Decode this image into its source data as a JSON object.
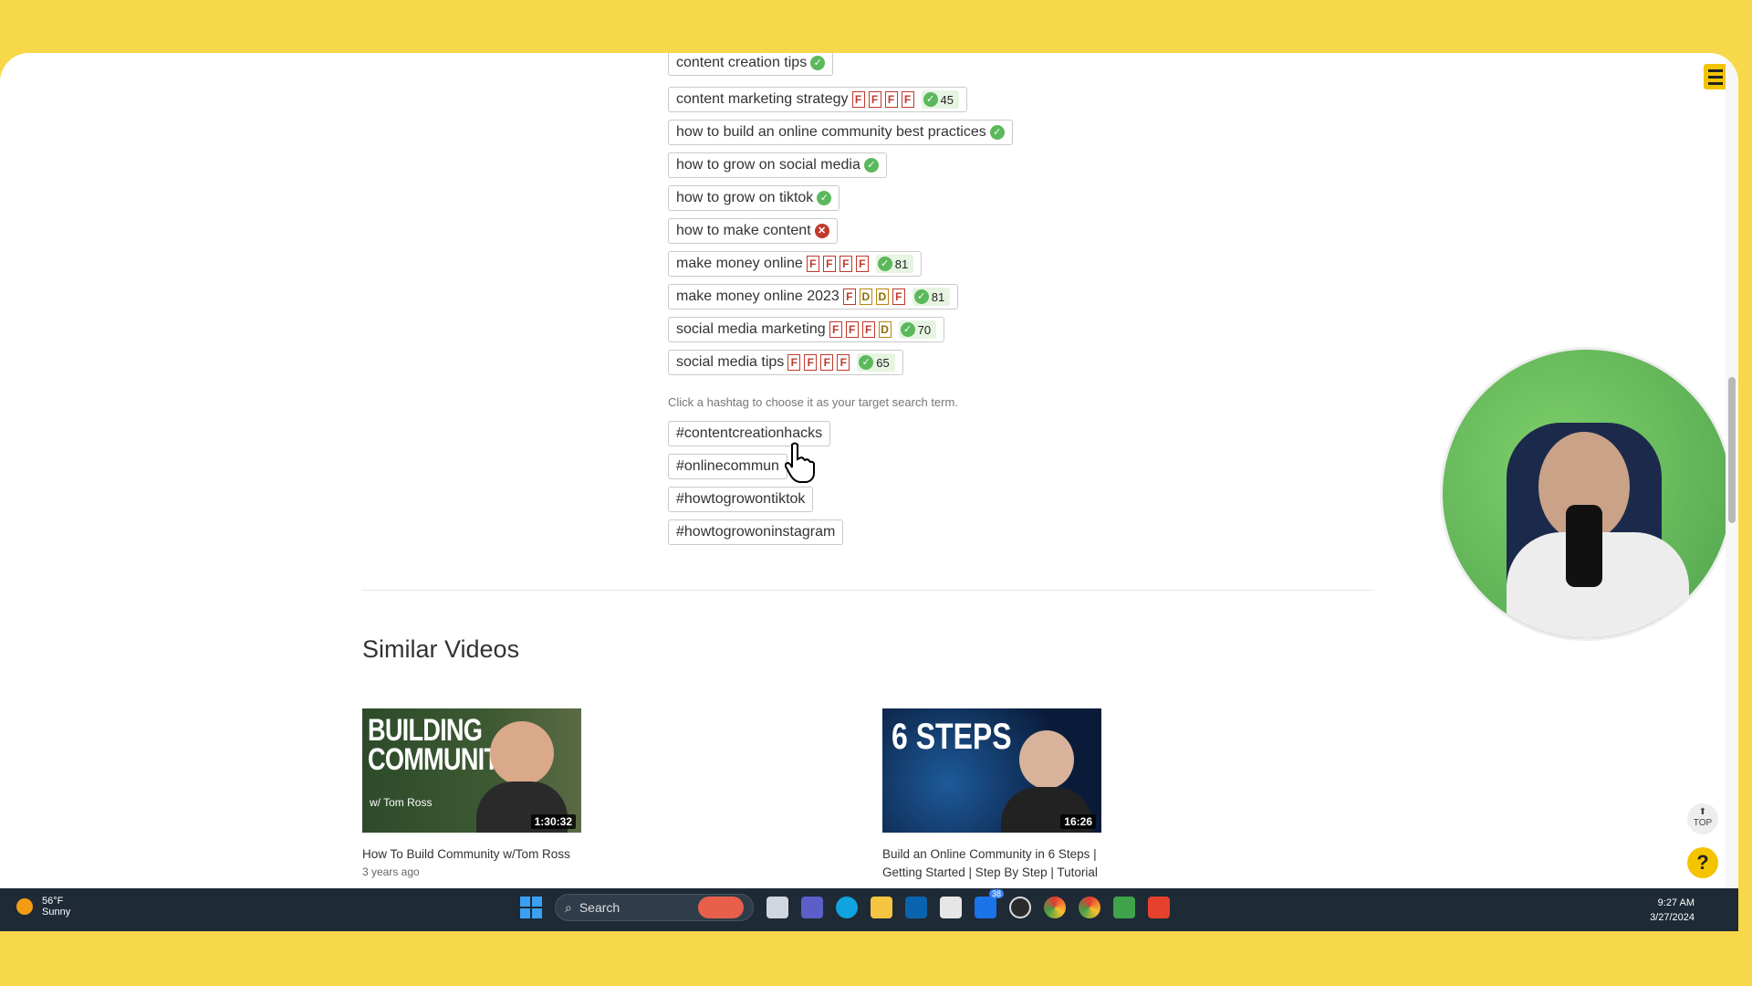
{
  "keywords": [
    {
      "text": "content creation tips",
      "status": "ok"
    },
    {
      "text": "content marketing strategy",
      "grades": [
        "F",
        "F",
        "F",
        "F"
      ],
      "score": "45",
      "status": "ok"
    },
    {
      "text": "how to build an online community best practices",
      "status": "ok"
    },
    {
      "text": "how to grow on social media",
      "status": "ok"
    },
    {
      "text": "how to grow on tiktok",
      "status": "ok"
    },
    {
      "text": "how to make content",
      "status": "no"
    },
    {
      "text": "make money online",
      "grades": [
        "F",
        "F",
        "F",
        "F"
      ],
      "score": "81",
      "status": "ok"
    },
    {
      "text": "make money online 2023",
      "grades": [
        "F",
        "D",
        "D",
        "F"
      ],
      "score": "81",
      "status": "ok"
    },
    {
      "text": "social media marketing",
      "grades": [
        "F",
        "F",
        "F",
        "D"
      ],
      "score": "70",
      "status": "ok"
    },
    {
      "text": "social media tips",
      "grades": [
        "F",
        "F",
        "F",
        "F"
      ],
      "score": "65",
      "status": "ok"
    }
  ],
  "hashtag_hint": "Click a hashtag to choose it as your target search term.",
  "hashtags": [
    "#contentcreationhacks",
    "#onlinecommun",
    "#howtogrowontiktok",
    "#howtogrowoninstagram"
  ],
  "similar_title": "Similar Videos",
  "videos": [
    {
      "thumb_text": "BUILDING COMMUNITY",
      "thumb_sub": "w/ Tom Ross",
      "duration": "1:30:32",
      "title": "How To Build Community w/Tom Ross",
      "age": "3 years ago"
    },
    {
      "thumb_text": "6 STEPS",
      "thumb_sub": "",
      "duration": "16:26",
      "title": "Build an Online Community in 6 Steps | Getting Started | Step By Step | Tutorial",
      "age": ""
    }
  ],
  "scroll_top_label": "TOP",
  "help_label": "?",
  "taskbar": {
    "temp": "56°F",
    "weather": "Sunny",
    "search_placeholder": "Search",
    "badge": "38",
    "time": "9:27 AM",
    "date": "3/27/2024"
  },
  "colors": {
    "accent": "#f2c400",
    "ok": "#5cb85c",
    "fail": "#c0392b",
    "taskbar": "#1e2a36"
  }
}
